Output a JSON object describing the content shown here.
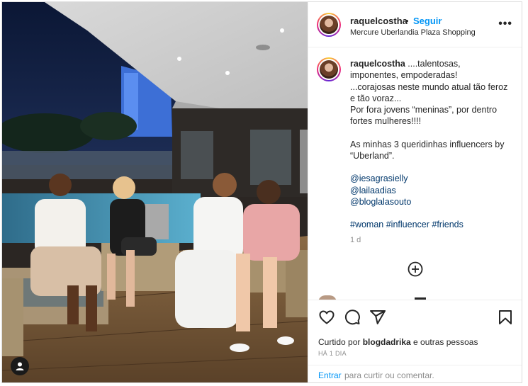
{
  "post": {
    "username": "raquelcostha",
    "follow_separator": "•",
    "follow_label": "Seguir",
    "location": "Mercure Uberlandia Plaza Shopping",
    "more_label": "•••"
  },
  "caption": {
    "username": "raquelcostha",
    "line1": " ....talentosas, imponentes, empoderadas!",
    "line2": "...corajosas neste mundo atual tão feroz e tão voraz...",
    "line3": "Por fora jovens “meninas”, por dentro fortes mulheres!!!!",
    "line4": "As minhas 3 queridinhas influencers by “Uberland”.",
    "mentions": [
      "@iesagrasielly",
      "@lailaadias",
      "@bloglalasouto"
    ],
    "hashtags": [
      "#woman",
      "#influencer",
      "#friends"
    ],
    "time": "1 d"
  },
  "actions": {
    "like_icon": "heart-icon",
    "comment_icon": "comment-icon",
    "share_icon": "share-icon",
    "save_icon": "bookmark-icon",
    "liked_prefix": "Curtido por ",
    "liked_user": "blogdadrika",
    "liked_suffix": " e outras pessoas",
    "time_ago": "HÁ 1 DIA"
  },
  "comment_box": {
    "login_link": "Entrar",
    "prompt": " para curtir ou comentar."
  },
  "colors": {
    "accent": "#0095f6",
    "text": "#262626",
    "muted": "#8e8e8e",
    "link": "#00376b",
    "border": "#dbdbdb"
  }
}
